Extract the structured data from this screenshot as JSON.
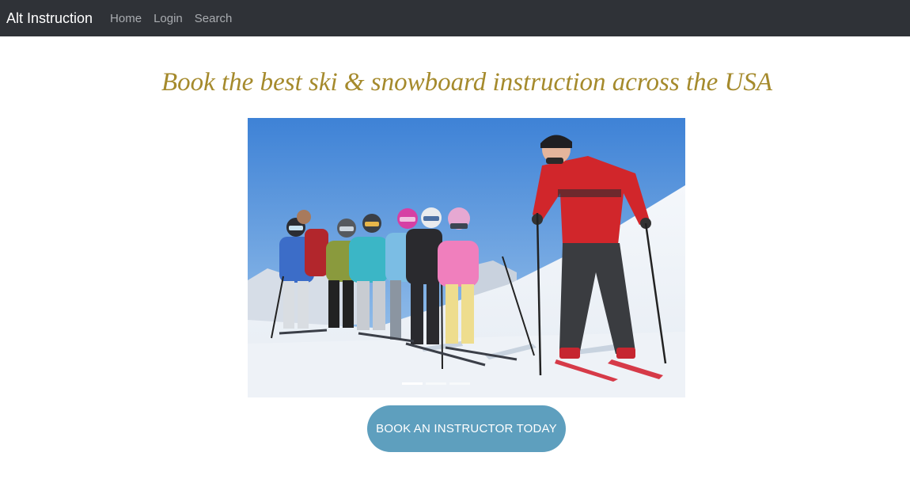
{
  "navbar": {
    "brand": "Alt Instruction",
    "links": [
      {
        "label": "Home"
      },
      {
        "label": "Login"
      },
      {
        "label": "Search"
      }
    ]
  },
  "hero": {
    "headline": "Book the best ski & snowboard instruction across the USA",
    "image_description_icon": "ski-lesson-photo",
    "carousel": {
      "slide_count": 3,
      "active_index": 0
    }
  },
  "cta": {
    "label": "BOOK AN INSTRUCTOR TODAY"
  },
  "colors": {
    "navbar_bg": "#2f3237",
    "headline": "#a58a2c",
    "cta_bg": "#5e9fbe",
    "brand_text": "#ffffff",
    "nav_link": "#a9acb0"
  }
}
